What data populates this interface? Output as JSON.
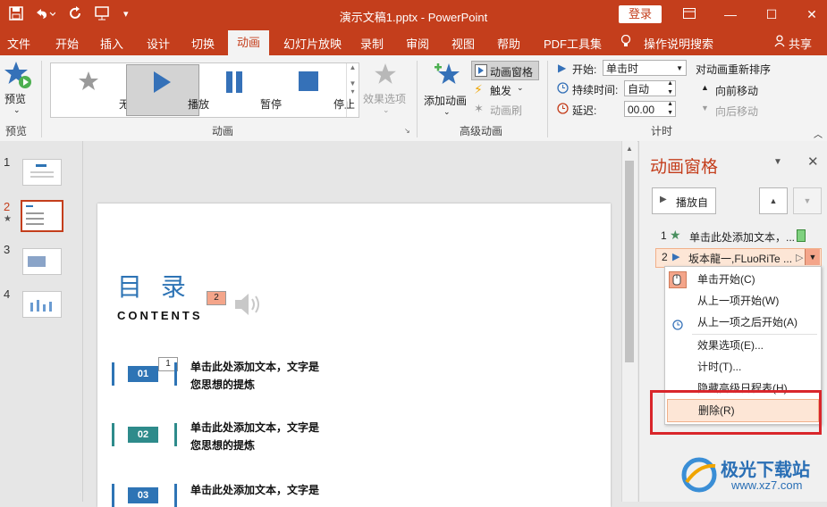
{
  "titlebar": {
    "document_title": "演示文稿1.pptx - PowerPoint",
    "login_label": "登录",
    "quick_access": [
      "save-icon",
      "undo-icon",
      "redo-icon",
      "present-icon",
      "customize-icon"
    ]
  },
  "tabs": {
    "items": [
      "文件",
      "开始",
      "插入",
      "设计",
      "切换",
      "动画",
      "幻灯片放映",
      "录制",
      "审阅",
      "视图",
      "帮助",
      "PDF工具集"
    ],
    "tell_me": "操作说明搜索",
    "share": "共享"
  },
  "ribbon": {
    "preview": {
      "label": "预览",
      "group": "预览"
    },
    "animation_group": {
      "label": "动画",
      "gallery": [
        "无",
        "播放",
        "暂停",
        "停止"
      ],
      "effect_options": "效果选项"
    },
    "advanced_group": {
      "label": "高级动画",
      "add_animation": "添加动画",
      "animation_pane": "动画窗格",
      "trigger": "触发",
      "painter": "动画刷"
    },
    "timing_group": {
      "label": "计时",
      "start_label": "开始:",
      "start_value": "单击时",
      "duration_label": "持续时间:",
      "duration_value": "自动",
      "delay_label": "延迟:",
      "delay_value": "00.00",
      "reorder_title": "对动画重新排序",
      "move_earlier": "向前移动",
      "move_later": "向后移动"
    }
  },
  "thumbnails": [
    {
      "num": "1"
    },
    {
      "num": "2",
      "star": "★"
    },
    {
      "num": "3"
    },
    {
      "num": "4"
    }
  ],
  "slide": {
    "title": "目 录",
    "subtitle": "CONTENTS",
    "tag2": "2",
    "tag1": "1",
    "items": [
      {
        "num": "01",
        "line1": "单击此处添加文本，文字是",
        "line2": "您思想的提炼"
      },
      {
        "num": "02",
        "line1": "单击此处添加文本，文字是",
        "line2": "您思想的提炼"
      },
      {
        "num": "03",
        "line1": "单击此处添加文本，文字是",
        "line2": ""
      }
    ]
  },
  "anim_pane": {
    "title": "动画窗格",
    "play_button": "播放自",
    "entries": [
      {
        "index": "1",
        "label": "单击此处添加文本，..."
      },
      {
        "index": "2",
        "label": "坂本龍一,FLuoRiTe ..."
      }
    ],
    "context_menu": [
      "单击开始(C)",
      "从上一项开始(W)",
      "从上一项之后开始(A)",
      "效果选项(E)...",
      "计时(T)...",
      "隐藏高级日程表(H)",
      "删除(R)"
    ]
  },
  "watermark": {
    "name": "极光下载站",
    "url": "www.xz7.com"
  },
  "colors": {
    "accent": "#c43e1c",
    "slide_blue": "#2e74b5",
    "teal": "#2e8b8b",
    "highlight_red": "#d9262b"
  }
}
